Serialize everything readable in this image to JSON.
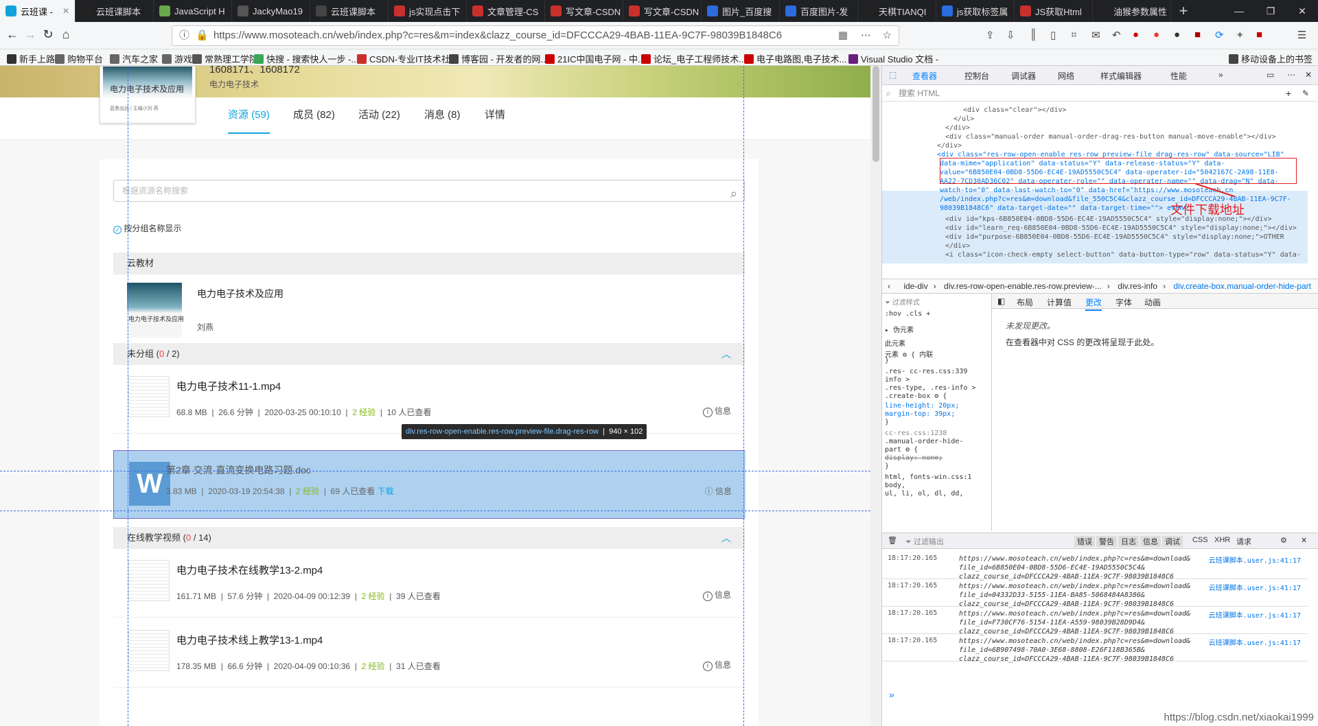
{
  "browser": {
    "tabs": [
      {
        "label": "云班课 - ",
        "active": true,
        "color": "#10a3dc"
      },
      {
        "label": "云班课脚本",
        "color": "#222"
      },
      {
        "label": "JavaScript H",
        "color": "#6aa84f"
      },
      {
        "label": "JackyMao19",
        "color": "#555"
      },
      {
        "label": "云班课脚本",
        "color": "#444"
      },
      {
        "label": "js实现点击下",
        "color": "#c9302c"
      },
      {
        "label": "文章管理-CS",
        "color": "#c9302c"
      },
      {
        "label": "写文章-CSDN",
        "color": "#c9302c"
      },
      {
        "label": "写文章-CSDN",
        "color": "#c9302c"
      },
      {
        "label": "图片_百度搜",
        "color": "#2b6cde"
      },
      {
        "label": "百度图片-发",
        "color": "#2b6cde"
      },
      {
        "label": "天棋TIANQI",
        "color": "#222"
      },
      {
        "label": "js获取标签属",
        "color": "#2b6cde"
      },
      {
        "label": "JS获取Html",
        "color": "#c9302c"
      },
      {
        "label": "油猴参数属性",
        "color": "#222"
      }
    ],
    "new_tab": "+",
    "url": "https://www.mosoteach.cn/web/index.php?c=res&m=index&clazz_course_id=DFCCCA29-4BAB-11EA-9C7F-98039B1848C6",
    "bookmarks": [
      {
        "label": "新手上路",
        "color": "#333"
      },
      {
        "label": "购物平台",
        "color": "#666"
      },
      {
        "label": "汽车之家",
        "color": "#666"
      },
      {
        "label": "游戏",
        "color": "#666"
      },
      {
        "label": "常熟理工学院",
        "color": "#555"
      },
      {
        "label": "快搜 - 搜索快人一步 -...",
        "color": "#3aa757"
      },
      {
        "label": "CSDN-专业IT技术社区",
        "color": "#c9302c"
      },
      {
        "label": "博客园 - 开发者的网...",
        "color": "#444"
      },
      {
        "label": "21IC中国电子网 - 中...",
        "color": "#c00"
      },
      {
        "label": "论坛_电子工程师技术...",
        "color": "#c00"
      },
      {
        "label": "电子电路图,电子技术...",
        "color": "#c00"
      },
      {
        "label": "Visual Studio 文档 -",
        "color": "#68217a"
      },
      {
        "label": "移动设备上的书签",
        "color": "#444"
      }
    ]
  },
  "page": {
    "course_name_line1": "1608171、1608172",
    "course_subtitle": "电力电子技术",
    "course_cover_title": "电力电子技术及应用",
    "course_cover_author": "蓝墨出品 | 主编小刘 燕",
    "nav": [
      "资源 (59)",
      "成员 (82)",
      "活动 (22)",
      "消息 (8)",
      "详情"
    ],
    "search_placeholder": "根据资源名称搜索",
    "group_by_label": "按分组名称显示",
    "textbook_header": "云教材",
    "textbook": {
      "title": "电力电子技术及应用",
      "author": "刘燕",
      "cover_label": "电力电子技术及应用"
    },
    "group1": {
      "name": "未分组",
      "open": "(",
      "done": "0",
      "sep": " / ",
      "total": "2",
      "close": ")"
    },
    "group2": {
      "name": "在线教学视频",
      "open": "(",
      "done": "0",
      "sep": " / ",
      "total": "14",
      "close": ")"
    },
    "resources": [
      {
        "title": "电力电子技术11-1.mp4",
        "size": "68.8 MB",
        "duration": "26.6 分钟",
        "date": "2020-03-25 00:10:10",
        "exp": "2 经验",
        "views": "10 人已查看",
        "info": "信息"
      },
      {
        "title": "第2章 交流-直流变换电路习题.doc",
        "size": "3.83 MB",
        "date": "2020-03-19 20:54:38",
        "exp": "2 经验",
        "views": "69 人已查看",
        "download": "下载",
        "info": "信息"
      },
      {
        "title": "电力电子技术在线教学13-2.mp4",
        "size": "161.71 MB",
        "duration": "57.6 分钟",
        "date": "2020-04-09 00:12:39",
        "exp": "2 经验",
        "views": "39 人已查看",
        "info": "信息"
      },
      {
        "title": "电力电子技术线上教学13-1.mp4",
        "size": "178.35 MB",
        "duration": "66.6 分钟",
        "date": "2020-04-09 00:10:36",
        "exp": "2 经验",
        "views": "31 人已查看",
        "info": "信息"
      }
    ],
    "tooltip_class": "div.res-row-open-enable.res-row.preview-file.drag-res-row",
    "tooltip_size": "940 × 102"
  },
  "devtools": {
    "tabs": [
      "查看器",
      "控制台",
      "调试器",
      "网络",
      "样式编辑器",
      "性能"
    ],
    "search_placeholder": "搜索 HTML",
    "html_lines": [
      "<div class=\"clear\"></div>",
      "</ul>",
      "</div>",
      "<div class=\"manual-order manual-order-drag-res-button manual-move-enable\"></div>",
      "</div>",
      "<div class=\"res-row-open-enable res-row preview-file drag-res-row\" data-source=\"LIB\"",
      "data-mime=\"application\" data-status=\"Y\" data-release-status=\"Y\" data-",
      "value=\"6B850E04-0BD8-55D6-EC4E-19AD5550C5C4\" data-operater-id=\"5042167C-2A98-11E8-",
      "AA22-7CD30AD36C02\" data-operater-role=\"\" data-operater-name=\"\" data-drag=\"N\" data-",
      "watch-to=\"0\" data-last-watch-to=\"0\" data-href=\"https://www.mosoteach.cn",
      "/web/index.php?c=res&m=download&file_550C5C4&clazz_course_id=DFCCCA29-4BAB-11EA-9C7F-",
      "98039B1848C6\" data-target-date=\"\" data-target-time=\"\"> event",
      "<div id=\"kps-6B850E04-0BD8-55D6-EC4E-19AD5550C5C4\" style=\"display:none;\"></div>",
      "<div id=\"learn_req-6B850E04-0BD8-55D6-EC4E-19AD5550C5C4\" style=\"display:none;\"></div>",
      "<div id=\"purpose-6B850E04-0BD8-55D6-EC4E-19AD5550C5C4\" style=\"display:none;\">OTHER",
      "</div>",
      "<i class=\"icon-check-empty select-button\" data-button-type=\"row\" data-status=\"Y\" data-"
    ],
    "annotation": "文件下载地址",
    "breadcrumb": [
      "ide-div",
      "div.res-row-open-enable.res-row.preview-...",
      "div.res-info",
      "div.create-box.manual-order-hide-part"
    ],
    "rules_filter": "过滤样式",
    "rules_lines": [
      ":hov .cls  +",
      "▸ 伪元素",
      "此元素",
      "元素 ⚙ {   内联",
      "}",
      ".res-     cc-res.css:339",
      "info >",
      ".res-type, .res-info >",
      ".create-box ⚙ {",
      "  line-height: 20px;",
      "  margin-top: 39px;",
      "}",
      "          cc-res.css:1238",
      ".manual-order-hide-",
      "part ⚙ {",
      "  display: none;",
      "}",
      "html,   fonts-win.css:1",
      "body,",
      "ul, li, ol, dl, dd,"
    ],
    "changes_tabs": [
      "布局",
      "计算值",
      "更改",
      "字体",
      "动画"
    ],
    "changes_msg1": "未发现更改。",
    "changes_msg2": "在查看器中对 CSS 的更改将呈现于此处。",
    "console_filter": "过滤输出",
    "console_buttons": [
      "错误",
      "警告",
      "日志",
      "信息",
      "调试",
      "CSS",
      "XHR",
      "请求"
    ],
    "logs": [
      {
        "time": "18:17:20.165",
        "l1": "https://www.mosoteach.cn/web/index.php?c=res&m=download&",
        "l2": "file_id=6B850E04-0BD8-55D6-EC4E-19AD5550C5C4&",
        "l3": "clazz_course_id=DFCCCA29-4BAB-11EA-9C7F-98039B1848C6",
        "src": "云班课脚本.user.js:41:17"
      },
      {
        "time": "18:17:20.165",
        "l1": "https://www.mosoteach.cn/web/index.php?c=res&m=download&",
        "l2": "file_id=04332D33-5155-11EA-BA85-5068484A8386&",
        "l3": "clazz_course_id=DFCCCA29-4BAB-11EA-9C7F-98039B1848C6",
        "src": "云班课脚本.user.js:41:17"
      },
      {
        "time": "18:17:20.165",
        "l1": "https://www.mosoteach.cn/web/index.php?c=res&m=download&",
        "l2": "file_id=F730CF76-5154-11EA-A559-98039B28D9D4&",
        "l3": "clazz_course_id=DFCCCA29-4BAB-11EA-9C7F-98039B1848C6",
        "src": "云班课脚本.user.js:41:17"
      },
      {
        "time": "18:17:20.165",
        "l1": "https://www.mosoteach.cn/web/index.php?c=res&m=download&",
        "l2": "file_id=6B907498-70A0-3E68-8808-E26F118B365B&",
        "l3": "clazz_course_id=DFCCCA29-4BAB-11EA-9C7F-98039B1848C6",
        "src": "云班课脚本.user.js:41:17"
      }
    ],
    "prompt": "»"
  },
  "watermark": "https://blog.csdn.net/xiaokai1999"
}
